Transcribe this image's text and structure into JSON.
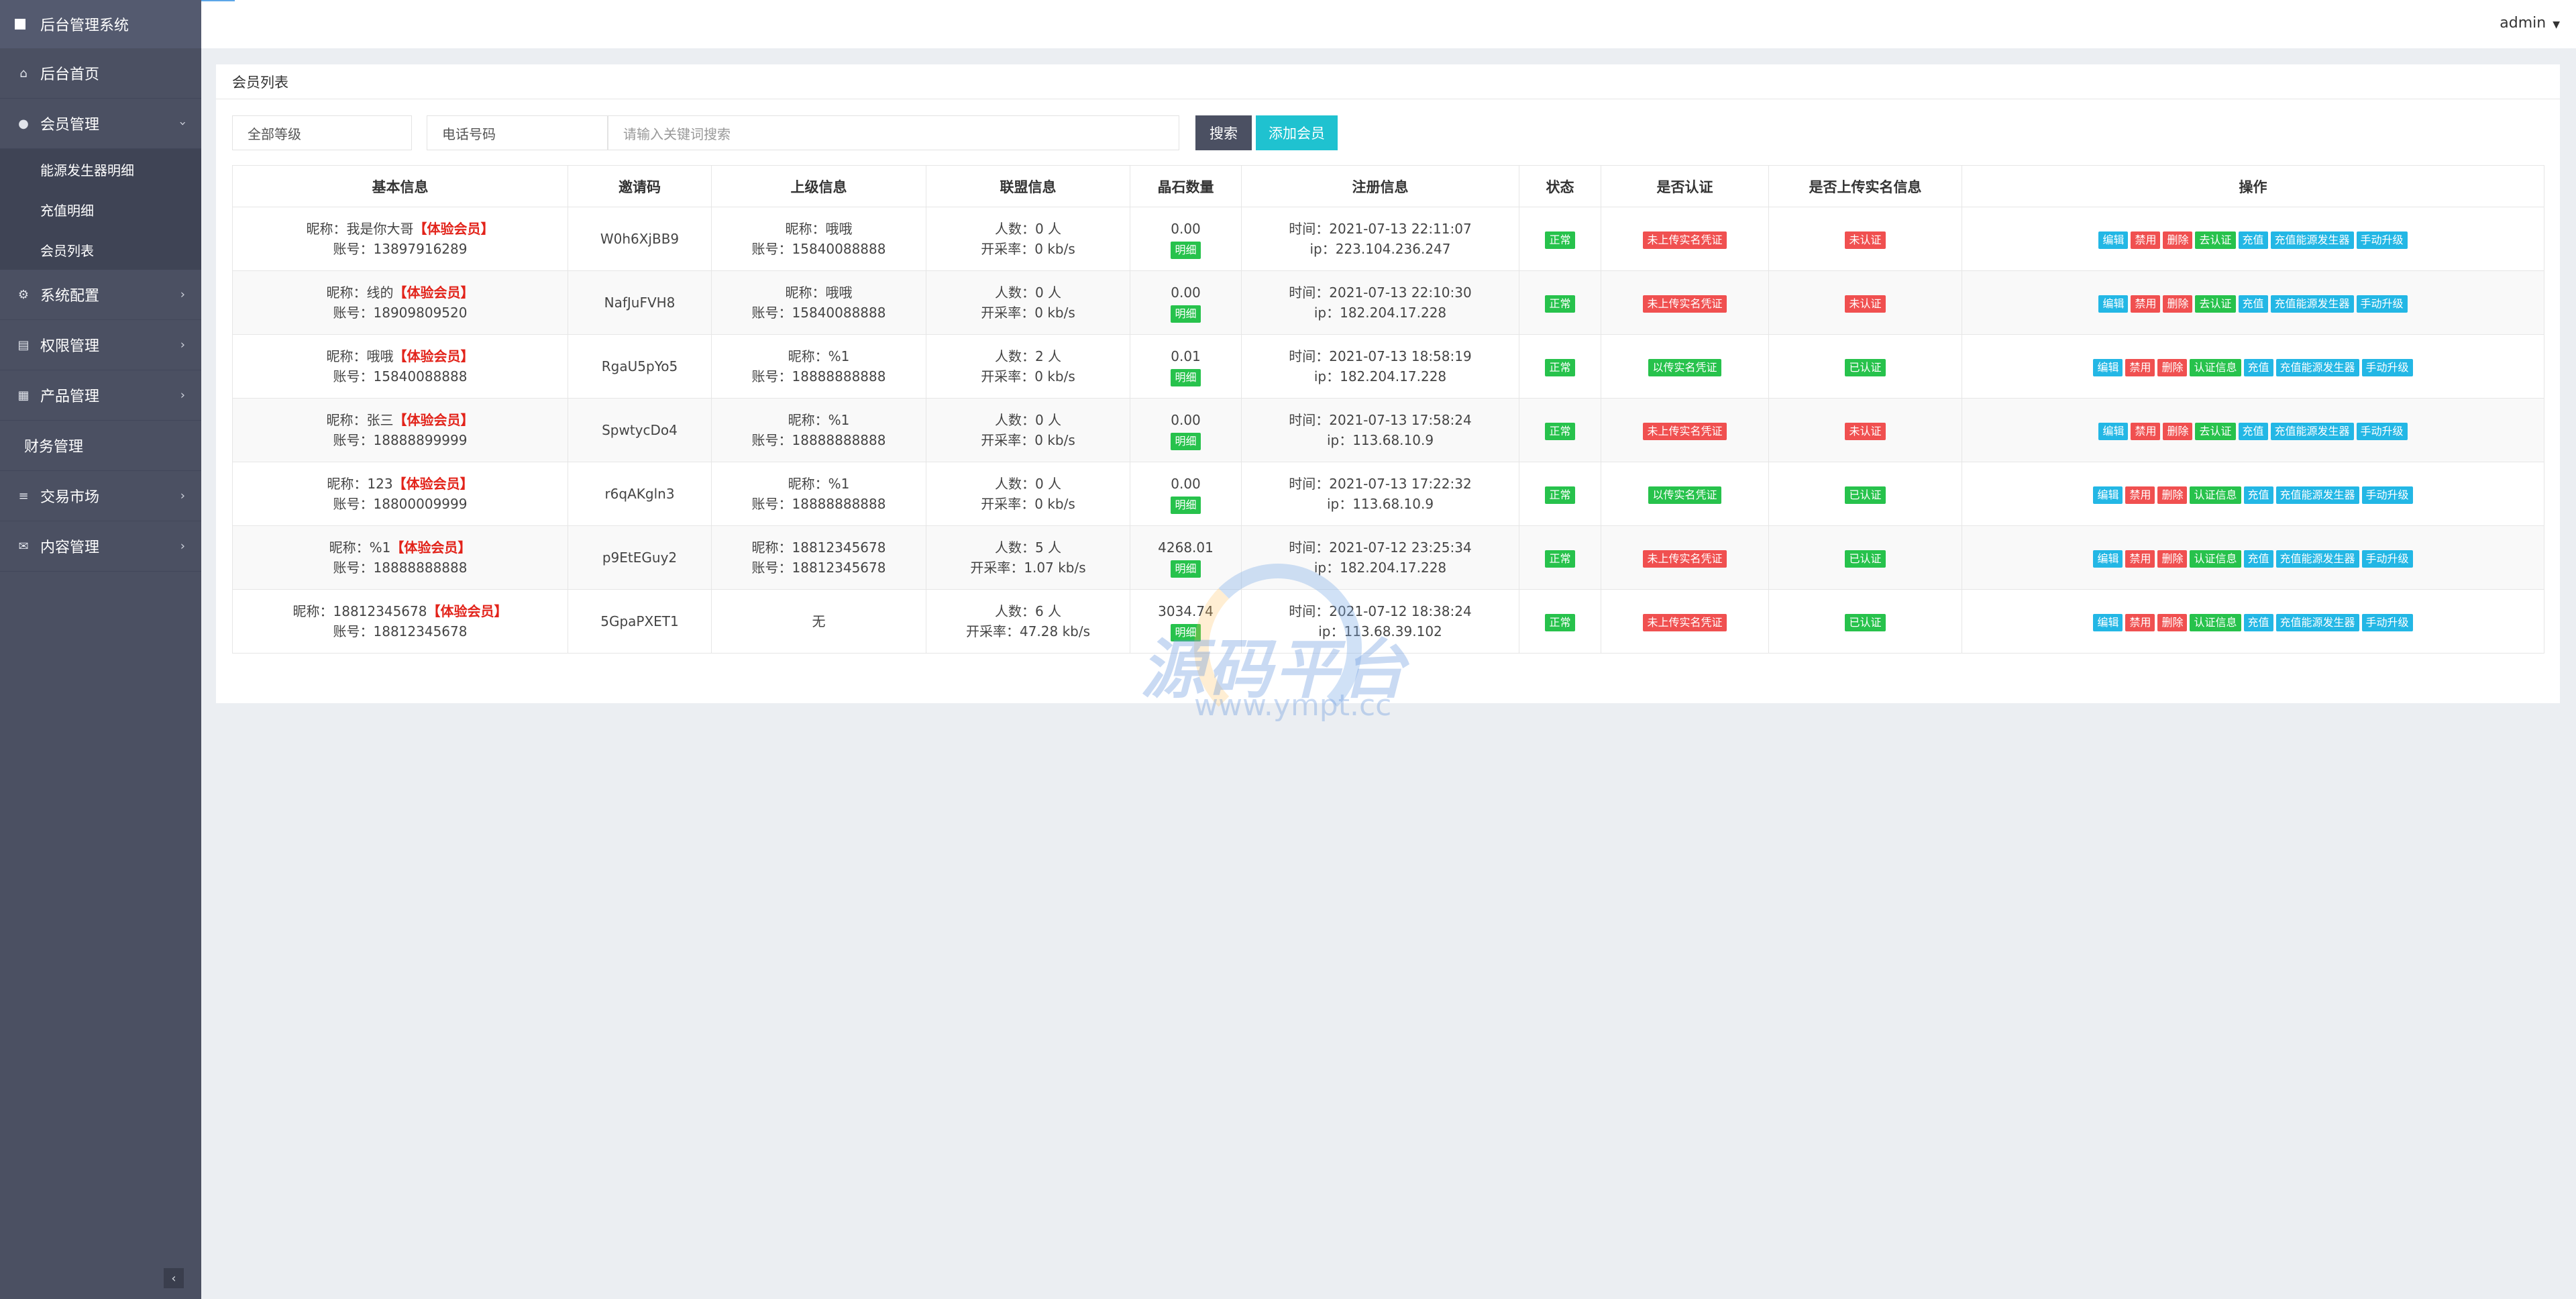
{
  "app": {
    "title": "后台管理系统"
  },
  "sidebar": {
    "items": [
      {
        "label": "后台首页",
        "icon": "home-icon",
        "arrow": false
      },
      {
        "label": "会员管理",
        "icon": "user-icon",
        "arrow": true,
        "open": true
      },
      {
        "label": "系统配置",
        "icon": "gears-icon",
        "arrow": true
      },
      {
        "label": "权限管理",
        "icon": "list-icon",
        "arrow": true
      },
      {
        "label": "产品管理",
        "icon": "grid-icon",
        "arrow": true
      },
      {
        "label": "财务管理",
        "icon": "",
        "arrow": false
      },
      {
        "label": "交易市场",
        "icon": "bars-icon",
        "arrow": true
      },
      {
        "label": "内容管理",
        "icon": "envelope-icon",
        "arrow": true
      }
    ],
    "sub_items": [
      "能源发生器明细",
      "充值明细",
      "会员列表"
    ]
  },
  "topbar": {
    "user": "admin"
  },
  "panel": {
    "title": "会员列表"
  },
  "filters": {
    "level": "全部等级",
    "phone": "电话号码",
    "keyword_placeholder": "请输入关键词搜索",
    "search_label": "搜索",
    "add_label": "添加会员"
  },
  "table": {
    "headers": [
      "基本信息",
      "邀请码",
      "上级信息",
      "联盟信息",
      "晶石数量",
      "注册信息",
      "状态",
      "是否认证",
      "是否上传实名信息",
      "操作"
    ],
    "rows": [
      {
        "nick": "昵称：我是你大哥",
        "vip": "【体验会员】",
        "account": "账号：13897916289",
        "code": "W0h6XjBB9",
        "parent_nick": "昵称：哦哦",
        "parent_acc": "账号：15840088888",
        "members": "人数：0 人",
        "rate": "开采率：0 kb/s",
        "crystal": "0.00",
        "detail": "明细",
        "time": "时间：2021-07-13 22:11:07",
        "ip": "ip：223.104.236.247",
        "status": "正常",
        "cert": "未上传实名凭证",
        "cert_color": "r",
        "upload": "未认证",
        "upload_color": "r",
        "actions": [
          [
            "编辑",
            "c"
          ],
          [
            "禁用",
            "r"
          ],
          [
            "删除",
            "r"
          ],
          [
            "去认证",
            "g"
          ],
          [
            "充值",
            "c"
          ],
          [
            "充值能源发生器",
            "c"
          ],
          [
            "手动升级",
            "c"
          ]
        ]
      },
      {
        "nick": "昵称：线的",
        "vip": "【体验会员】",
        "account": "账号：18909809520",
        "code": "NafJuFVH8",
        "parent_nick": "昵称：哦哦",
        "parent_acc": "账号：15840088888",
        "members": "人数：0 人",
        "rate": "开采率：0 kb/s",
        "crystal": "0.00",
        "detail": "明细",
        "time": "时间：2021-07-13 22:10:30",
        "ip": "ip：182.204.17.228",
        "status": "正常",
        "cert": "未上传实名凭证",
        "cert_color": "r",
        "upload": "未认证",
        "upload_color": "r",
        "actions": [
          [
            "编辑",
            "c"
          ],
          [
            "禁用",
            "r"
          ],
          [
            "删除",
            "r"
          ],
          [
            "去认证",
            "g"
          ],
          [
            "充值",
            "c"
          ],
          [
            "充值能源发生器",
            "c"
          ],
          [
            "手动升级",
            "c"
          ]
        ]
      },
      {
        "nick": "昵称：哦哦",
        "vip": "【体验会员】",
        "account": "账号：15840088888",
        "code": "RgaU5pYo5",
        "parent_nick": "昵称：%1",
        "parent_acc": "账号：18888888888",
        "members": "人数：2 人",
        "rate": "开采率：0 kb/s",
        "crystal": "0.01",
        "detail": "明细",
        "time": "时间：2021-07-13 18:58:19",
        "ip": "ip：182.204.17.228",
        "status": "正常",
        "cert": "以传实名凭证",
        "cert_color": "g",
        "upload": "已认证",
        "upload_color": "g",
        "actions": [
          [
            "编辑",
            "c"
          ],
          [
            "禁用",
            "r"
          ],
          [
            "删除",
            "r"
          ],
          [
            "认证信息",
            "g"
          ],
          [
            "充值",
            "c"
          ],
          [
            "充值能源发生器",
            "c"
          ],
          [
            "手动升级",
            "c"
          ]
        ]
      },
      {
        "nick": "昵称：张三",
        "vip": "【体验会员】",
        "account": "账号：18888899999",
        "code": "SpwtycDo4",
        "parent_nick": "昵称：%1",
        "parent_acc": "账号：18888888888",
        "members": "人数：0 人",
        "rate": "开采率：0 kb/s",
        "crystal": "0.00",
        "detail": "明细",
        "time": "时间：2021-07-13 17:58:24",
        "ip": "ip：113.68.10.9",
        "status": "正常",
        "cert": "未上传实名凭证",
        "cert_color": "r",
        "upload": "未认证",
        "upload_color": "r",
        "actions": [
          [
            "编辑",
            "c"
          ],
          [
            "禁用",
            "r"
          ],
          [
            "删除",
            "r"
          ],
          [
            "去认证",
            "g"
          ],
          [
            "充值",
            "c"
          ],
          [
            "充值能源发生器",
            "c"
          ],
          [
            "手动升级",
            "c"
          ]
        ]
      },
      {
        "nick": "昵称：123",
        "vip": "【体验会员】",
        "account": "账号：18800009999",
        "code": "r6qAKgln3",
        "parent_nick": "昵称：%1",
        "parent_acc": "账号：18888888888",
        "members": "人数：0 人",
        "rate": "开采率：0 kb/s",
        "crystal": "0.00",
        "detail": "明细",
        "time": "时间：2021-07-13 17:22:32",
        "ip": "ip：113.68.10.9",
        "status": "正常",
        "cert": "以传实名凭证",
        "cert_color": "g",
        "upload": "已认证",
        "upload_color": "g",
        "actions": [
          [
            "编辑",
            "c"
          ],
          [
            "禁用",
            "r"
          ],
          [
            "删除",
            "r"
          ],
          [
            "认证信息",
            "g"
          ],
          [
            "充值",
            "c"
          ],
          [
            "充值能源发生器",
            "c"
          ],
          [
            "手动升级",
            "c"
          ]
        ]
      },
      {
        "nick": "昵称：%1",
        "vip": "【体验会员】",
        "account": "账号：18888888888",
        "code": "p9EtEGuy2",
        "parent_nick": "昵称：18812345678",
        "parent_acc": "账号：18812345678",
        "members": "人数：5 人",
        "rate": "开采率：1.07 kb/s",
        "crystal": "4268.01",
        "detail": "明细",
        "time": "时间：2021-07-12 23:25:34",
        "ip": "ip：182.204.17.228",
        "status": "正常",
        "cert": "未上传实名凭证",
        "cert_color": "r",
        "upload": "已认证",
        "upload_color": "g",
        "actions": [
          [
            "编辑",
            "c"
          ],
          [
            "禁用",
            "r"
          ],
          [
            "删除",
            "r"
          ],
          [
            "认证信息",
            "g"
          ],
          [
            "充值",
            "c"
          ],
          [
            "充值能源发生器",
            "c"
          ],
          [
            "手动升级",
            "c"
          ]
        ]
      },
      {
        "nick": "昵称：18812345678",
        "vip": "【体验会员】",
        "account": "账号：18812345678",
        "code": "5GpaPXET1",
        "parent_nick": "无",
        "parent_acc": "",
        "members": "人数：6 人",
        "rate": "开采率：47.28 kb/s",
        "crystal": "3034.74",
        "detail": "明细",
        "time": "时间：2021-07-12 18:38:24",
        "ip": "ip：113.68.39.102",
        "status": "正常",
        "cert": "未上传实名凭证",
        "cert_color": "r",
        "upload": "已认证",
        "upload_color": "g",
        "actions": [
          [
            "编辑",
            "c"
          ],
          [
            "禁用",
            "r"
          ],
          [
            "删除",
            "r"
          ],
          [
            "认证信息",
            "g"
          ],
          [
            "充值",
            "c"
          ],
          [
            "充值能源发生器",
            "c"
          ],
          [
            "手动升级",
            "c"
          ]
        ]
      }
    ]
  },
  "watermark": {
    "text": "源码平台",
    "url": "www.ympt.cc"
  }
}
